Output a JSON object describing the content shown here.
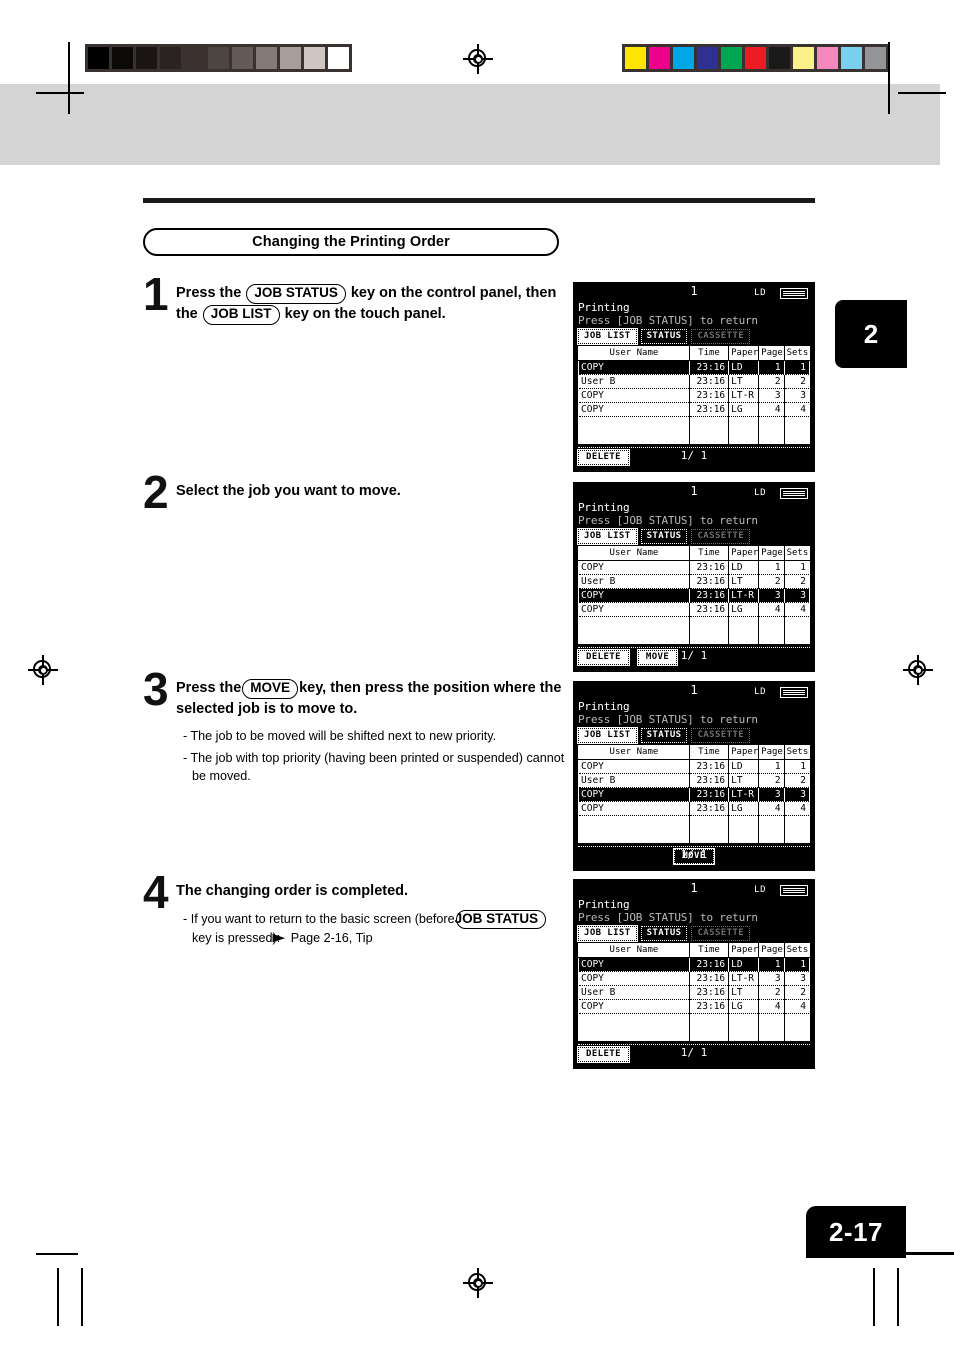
{
  "page": {
    "number": "2-17",
    "chapter_tab": "2",
    "section_title": "Changing the Printing Order"
  },
  "calibration": {
    "gray_swatches": [
      "#000000",
      "#0d0a0a",
      "#1b1615",
      "#2a2321",
      "#3a312f",
      "#4d4542",
      "#645b57",
      "#837a75",
      "#a79e99",
      "#cfc6c1",
      "#ffffff"
    ],
    "color_swatches": [
      "#ffe600",
      "#ec008c",
      "#00a7e7",
      "#2e3192",
      "#00a651",
      "#ed1c24",
      "#1a1a1a",
      "#fbf08a",
      "#f589bf",
      "#78cff0",
      "#939598"
    ]
  },
  "steps": [
    {
      "num": "1",
      "head_parts": [
        {
          "type": "text",
          "value": "Press the "
        },
        {
          "type": "key",
          "value": "JOB STATUS"
        },
        {
          "type": "text",
          "value": " key on the control panel, then the "
        },
        {
          "type": "key",
          "value": "JOB LIST"
        },
        {
          "type": "text",
          "value": " key on the touch panel."
        }
      ],
      "notes": []
    },
    {
      "num": "2",
      "head_parts": [
        {
          "type": "text",
          "value": "Select the job you want to move."
        }
      ],
      "notes": []
    },
    {
      "num": "3",
      "head_parts": [
        {
          "type": "text",
          "value": "Press the"
        },
        {
          "type": "key",
          "value": "MOVE"
        },
        {
          "type": "text",
          "value": "key, then press the position where the selected job is to move to."
        }
      ],
      "notes": [
        "- The job to be moved will be shifted next to new priority.",
        "- The job with top priority (having been printed or suspended) cannot be moved."
      ]
    },
    {
      "num": "4",
      "head_parts": [
        {
          "type": "text",
          "value": "The changing order is completed."
        }
      ],
      "notes": [],
      "note_rich": {
        "lead": "- If you want to return to the basic screen (before",
        "key": "JOB STATUS",
        "tail_line2_pre": "key is pressed): ",
        "arrow": "▶",
        "tail_line2_post": "Page 2-16, Tip"
      }
    }
  ],
  "lcd_common": {
    "copies": "1",
    "paper_size": "LD",
    "message_line1": "Printing",
    "message_line2": "Press [JOB STATUS] to return",
    "tabs": [
      {
        "label": "JOB LIST",
        "state": "selected"
      },
      {
        "label": "STATUS",
        "state": "normal"
      },
      {
        "label": "CASSETTE",
        "state": "disabled"
      }
    ],
    "columns": [
      "User Name",
      "Time",
      "Paper",
      "Pages",
      "Sets"
    ],
    "page_indicator": "1/ 1",
    "delete_label": "DELETE",
    "move_label": "MOVE",
    "tray_icon": "paper-tray-icon"
  },
  "lcd_screens": [
    {
      "id": "screen-step-1",
      "rows": [
        {
          "name": "COPY",
          "time": "23:16",
          "paper": "LD",
          "pages": "1",
          "sets": "1",
          "highlight": true
        },
        {
          "name": "User B",
          "time": "23:16",
          "paper": "LT",
          "pages": "2",
          "sets": "2",
          "highlight": false
        },
        {
          "name": "COPY",
          "time": "23:16",
          "paper": "LT-R",
          "pages": "3",
          "sets": "3",
          "highlight": false
        },
        {
          "name": "COPY",
          "time": "23:16",
          "paper": "LG",
          "pages": "4",
          "sets": "4",
          "highlight": false
        }
      ],
      "buttons": [
        {
          "label": "DELETE",
          "state": "normal"
        }
      ],
      "footer_layout": "left"
    },
    {
      "id": "screen-step-2",
      "rows": [
        {
          "name": "COPY",
          "time": "23:16",
          "paper": "LD",
          "pages": "1",
          "sets": "1",
          "highlight": false
        },
        {
          "name": "User B",
          "time": "23:16",
          "paper": "LT",
          "pages": "2",
          "sets": "2",
          "highlight": false
        },
        {
          "name": "COPY",
          "time": "23:16",
          "paper": "LT-R",
          "pages": "3",
          "sets": "3",
          "highlight": true
        },
        {
          "name": "COPY",
          "time": "23:16",
          "paper": "LG",
          "pages": "4",
          "sets": "4",
          "highlight": false
        }
      ],
      "buttons": [
        {
          "label": "DELETE",
          "state": "normal"
        },
        {
          "label": "MOVE",
          "state": "normal"
        }
      ],
      "footer_layout": "left"
    },
    {
      "id": "screen-step-3",
      "rows": [
        {
          "name": "COPY",
          "time": "23:16",
          "paper": "LD",
          "pages": "1",
          "sets": "1",
          "highlight": false
        },
        {
          "name": "User B",
          "time": "23:16",
          "paper": "LT",
          "pages": "2",
          "sets": "2",
          "highlight": false
        },
        {
          "name": "COPY",
          "time": "23:16",
          "paper": "LT-R",
          "pages": "3",
          "sets": "3",
          "highlight": true
        },
        {
          "name": "COPY",
          "time": "23:16",
          "paper": "LG",
          "pages": "4",
          "sets": "4",
          "highlight": false
        }
      ],
      "buttons": [
        {
          "label": "MOVE",
          "state": "pressed"
        }
      ],
      "footer_layout": "center"
    },
    {
      "id": "screen-step-4",
      "rows": [
        {
          "name": "COPY",
          "time": "23:16",
          "paper": "LD",
          "pages": "1",
          "sets": "1",
          "highlight": true
        },
        {
          "name": "COPY",
          "time": "23:16",
          "paper": "LT-R",
          "pages": "3",
          "sets": "3",
          "highlight": false
        },
        {
          "name": "User B",
          "time": "23:16",
          "paper": "LT",
          "pages": "2",
          "sets": "2",
          "highlight": false
        },
        {
          "name": "COPY",
          "time": "23:16",
          "paper": "LG",
          "pages": "4",
          "sets": "4",
          "highlight": false
        }
      ],
      "buttons": [
        {
          "label": "DELETE",
          "state": "normal"
        }
      ],
      "footer_layout": "left"
    }
  ]
}
